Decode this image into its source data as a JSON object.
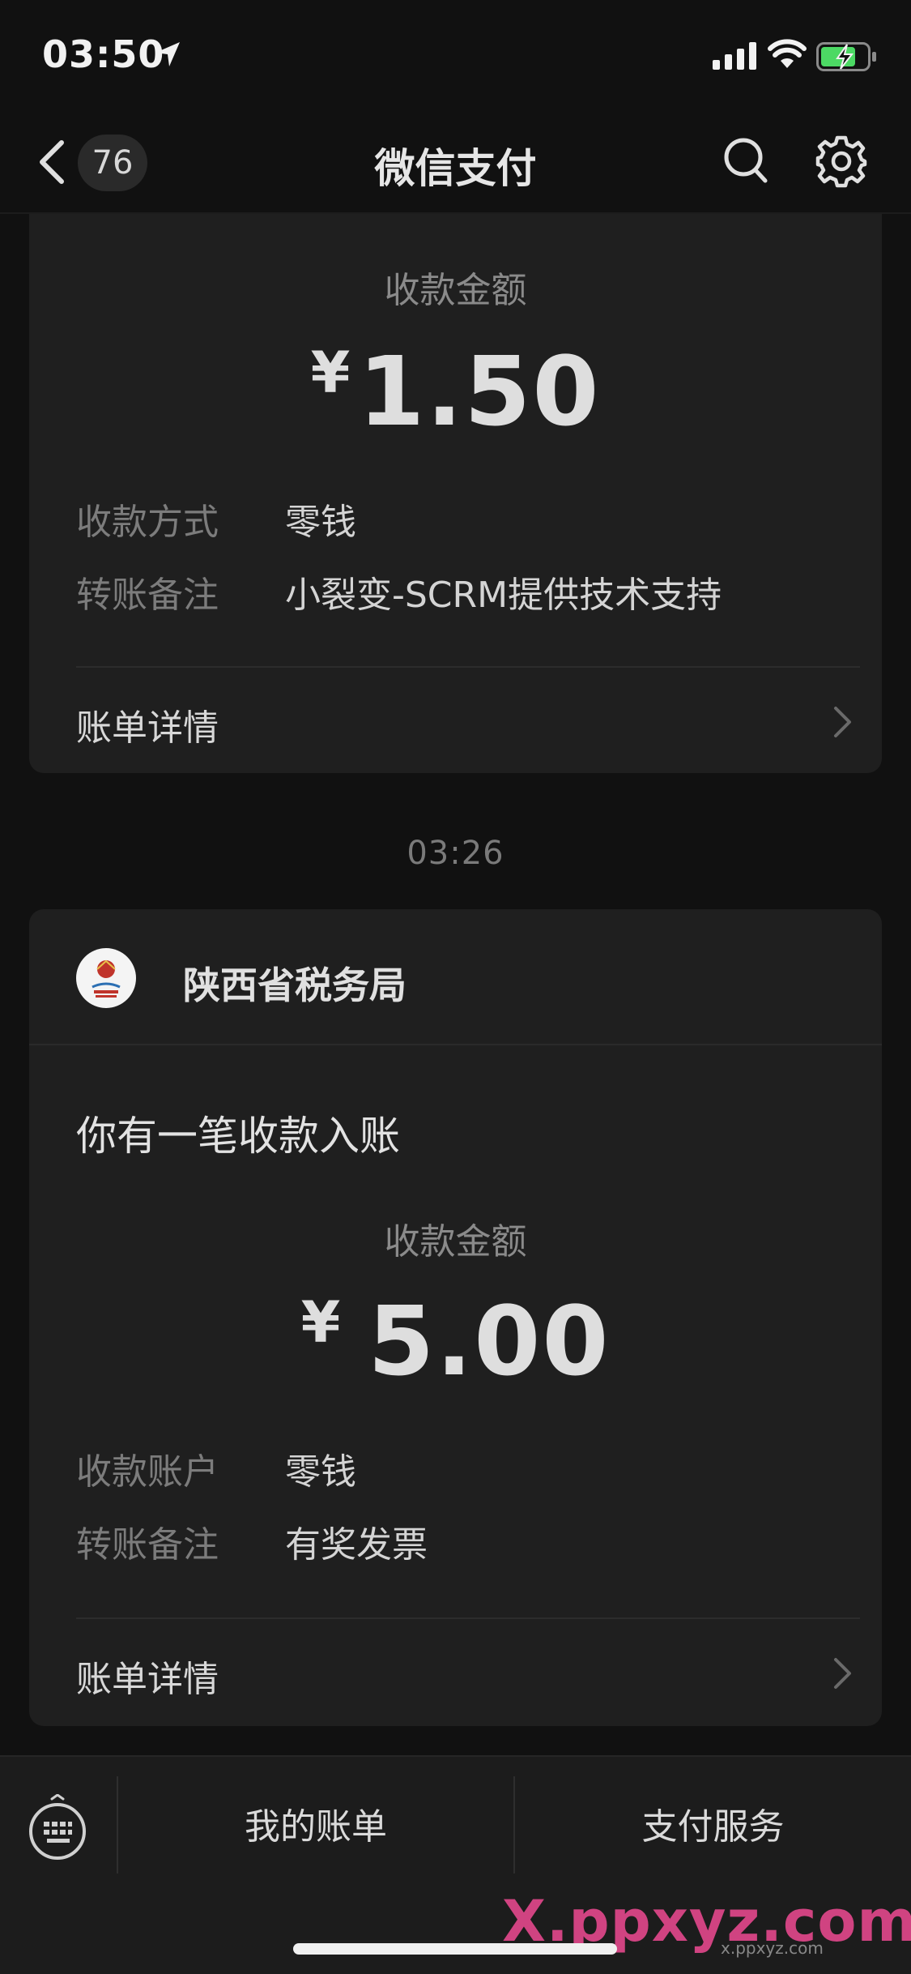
{
  "status_bar": {
    "time": "03:50"
  },
  "nav": {
    "badge_count": "76",
    "title": "微信支付"
  },
  "card1": {
    "amount_label": "收款金额",
    "currency": "¥",
    "amount": "1.50",
    "rows": [
      {
        "key": "收款方式",
        "value": "零钱"
      },
      {
        "key": "转账备注",
        "value": "小裂变-SCRM提供技术支持"
      }
    ],
    "detail_label": "账单详情"
  },
  "timestamp": "03:26",
  "card2": {
    "org_name": "陕西省税务局",
    "headline": "你有一笔收款入账",
    "amount_label": "收款金额",
    "currency": "¥",
    "amount": "5.00",
    "rows": [
      {
        "key": "收款账户",
        "value": "零钱"
      },
      {
        "key": "转账备注",
        "value": "有奖发票"
      }
    ],
    "detail_label": "账单详情"
  },
  "bottom_bar": {
    "tab1": "我的账单",
    "tab2": "支付服务"
  },
  "watermark": {
    "main": "X.ppxyz.com",
    "sub": "x.ppxyz.com"
  },
  "colors": {
    "background": "#111111",
    "card": "#1f1f1f",
    "battery": "#4cd964"
  }
}
